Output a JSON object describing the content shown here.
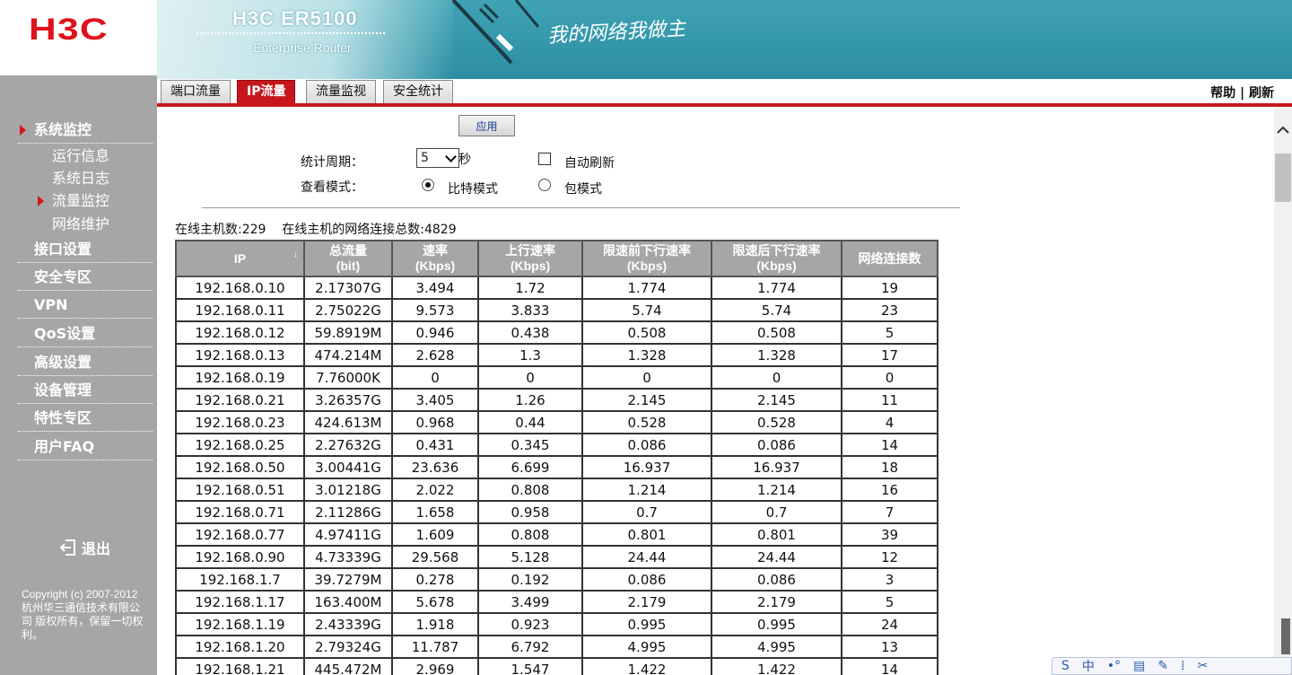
{
  "logo": "H3C",
  "banner": {
    "product": "H3C ER5100",
    "subtitle": "Enterprise Router",
    "slogan": "我的网络我做主"
  },
  "tabs": [
    {
      "label": "端口流量",
      "active": false
    },
    {
      "label": "IP流量",
      "active": true
    },
    {
      "label": "流量监视",
      "active": false
    },
    {
      "label": "安全统计",
      "active": false
    }
  ],
  "header_links": {
    "help": "帮助",
    "sep": "|",
    "refresh": "刷新"
  },
  "sidebar": {
    "items": [
      {
        "label": "系统监控",
        "expanded": true
      },
      {
        "label": "接口设置"
      },
      {
        "label": "安全专区"
      },
      {
        "label": "VPN"
      },
      {
        "label": "QoS设置"
      },
      {
        "label": "高级设置"
      },
      {
        "label": "设备管理"
      },
      {
        "label": "特性专区"
      },
      {
        "label": "用户FAQ"
      }
    ],
    "subitems": [
      {
        "label": "运行信息"
      },
      {
        "label": "系统日志"
      },
      {
        "label": "流量监控",
        "active": true
      },
      {
        "label": "网络维护"
      }
    ],
    "logout": "退出",
    "copyright": "Copyright (c) 2007-2012 杭州华三通信技术有限公司 版权所有，保留一切权利。"
  },
  "form": {
    "apply": "应用",
    "period_label": "统计周期：",
    "period_value": "5",
    "period_unit": "秒",
    "auto_refresh": "自动刷新",
    "mode_label": "查看模式：",
    "mode_bit": "比特模式",
    "mode_packet": "包模式"
  },
  "summary": {
    "hosts_label": "在线主机数:",
    "hosts": "229",
    "conns_label": "在线主机的网络连接总数:",
    "conns": "4829"
  },
  "table": {
    "headers": [
      [
        "IP",
        ""
      ],
      [
        "总流量",
        "(bit)"
      ],
      [
        "速率",
        "(Kbps)"
      ],
      [
        "上行速率",
        "(Kbps)"
      ],
      [
        "限速前下行速率",
        "(Kbps)"
      ],
      [
        "限速后下行速率",
        "(Kbps)"
      ],
      [
        "网络连接数",
        ""
      ]
    ],
    "sort_indicator": "↓",
    "rows": [
      [
        "192.168.0.10",
        "2.17307G",
        "3.494",
        "1.72",
        "1.774",
        "1.774",
        "19"
      ],
      [
        "192.168.0.11",
        "2.75022G",
        "9.573",
        "3.833",
        "5.74",
        "5.74",
        "23"
      ],
      [
        "192.168.0.12",
        "59.8919M",
        "0.946",
        "0.438",
        "0.508",
        "0.508",
        "5"
      ],
      [
        "192.168.0.13",
        "474.214M",
        "2.628",
        "1.3",
        "1.328",
        "1.328",
        "17"
      ],
      [
        "192.168.0.19",
        "7.76000K",
        "0",
        "0",
        "0",
        "0",
        "0"
      ],
      [
        "192.168.0.21",
        "3.26357G",
        "3.405",
        "1.26",
        "2.145",
        "2.145",
        "11"
      ],
      [
        "192.168.0.23",
        "424.613M",
        "0.968",
        "0.44",
        "0.528",
        "0.528",
        "4"
      ],
      [
        "192.168.0.25",
        "2.27632G",
        "0.431",
        "0.345",
        "0.086",
        "0.086",
        "14"
      ],
      [
        "192.168.0.50",
        "3.00441G",
        "23.636",
        "6.699",
        "16.937",
        "16.937",
        "18"
      ],
      [
        "192.168.0.51",
        "3.01218G",
        "2.022",
        "0.808",
        "1.214",
        "1.214",
        "16"
      ],
      [
        "192.168.0.71",
        "2.11286G",
        "1.658",
        "0.958",
        "0.7",
        "0.7",
        "7"
      ],
      [
        "192.168.0.77",
        "4.97411G",
        "1.609",
        "0.808",
        "0.801",
        "0.801",
        "39"
      ],
      [
        "192.168.0.90",
        "4.73339G",
        "29.568",
        "5.128",
        "24.44",
        "24.44",
        "12"
      ],
      [
        "192.168.1.7",
        "39.7279M",
        "0.278",
        "0.192",
        "0.086",
        "0.086",
        "3"
      ],
      [
        "192.168.1.17",
        "163.400M",
        "5.678",
        "3.499",
        "2.179",
        "2.179",
        "5"
      ],
      [
        "192.168.1.19",
        "2.43339G",
        "1.918",
        "0.923",
        "0.995",
        "0.995",
        "24"
      ],
      [
        "192.168.1.20",
        "2.79324G",
        "11.787",
        "6.792",
        "4.995",
        "4.995",
        "13"
      ],
      [
        "192.168.1.21",
        "445.472M",
        "2.969",
        "1.547",
        "1.422",
        "1.422",
        "14"
      ]
    ]
  },
  "ime": [
    "S",
    "中",
    "•°",
    "▤",
    "✎",
    "⁞",
    "✂"
  ],
  "colors": {
    "accent": "#c8161d",
    "sidebar": "#a6a6a6",
    "banner": "#2b8ea3"
  }
}
